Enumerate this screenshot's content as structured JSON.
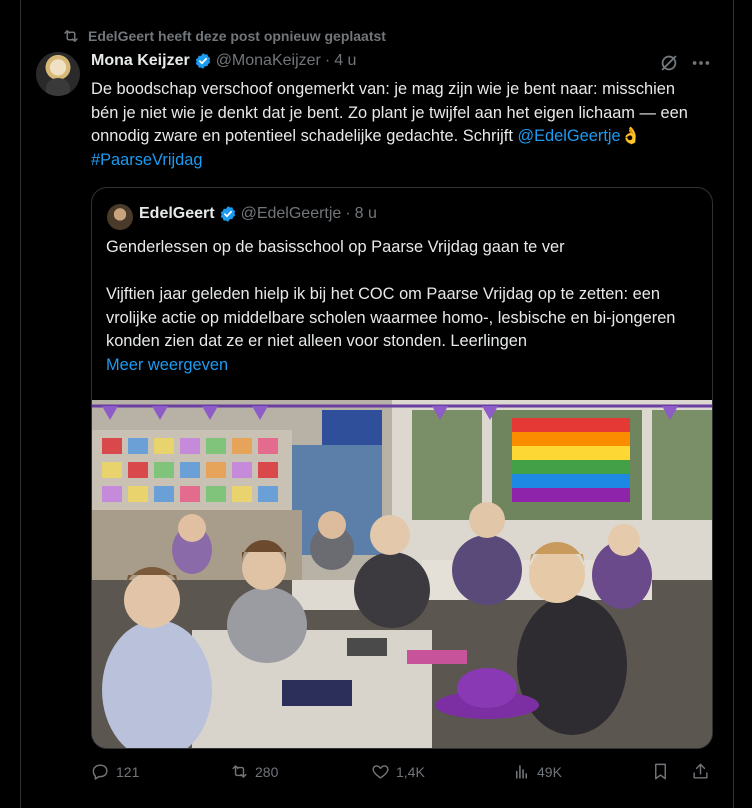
{
  "repost": {
    "label": "EdelGeert heeft deze post opnieuw geplaatst",
    "icon": "repost-icon"
  },
  "post": {
    "display_name": "Mona Keijzer",
    "handle": "@MonaKeijzer",
    "separator": "·",
    "time": "4 u",
    "text_main": "De boodschap verschoof ongemerkt van: je mag zijn wie je bent naar: misschien bén je niet wie je denkt dat je bent. Zo plant je twijfel aan het eigen lichaam — een onnodig zware en potentieel schadelijke gedachte. Schrijft ",
    "mention": "@EdelGeertje",
    "emoji": "👌",
    "hashtag": "#PaarseVrijdag"
  },
  "quote": {
    "display_name": "EdelGeert",
    "handle": "@EdelGeertje",
    "separator": "·",
    "time": "8 u",
    "text": "Genderlessen op de basisschool op Paarse Vrijdag gaan te ver\n\nVijftien jaar geleden hielp ik bij het COC om Paarse Vrijdag op te zetten: een vrolijke actie op middelbare scholen waarmee homo-, lesbische en bi-jongeren konden zien dat ze er niet alleen voor stonden. Leerlingen",
    "show_more": "Meer weergeven"
  },
  "actions": {
    "replies": "121",
    "reposts": "280",
    "likes": "1,4K",
    "views": "49K"
  },
  "colors": {
    "background": "#000000",
    "text": "#e7e9ea",
    "muted": "#71767b",
    "accent": "#1d9bf0",
    "border": "#2f3336"
  }
}
